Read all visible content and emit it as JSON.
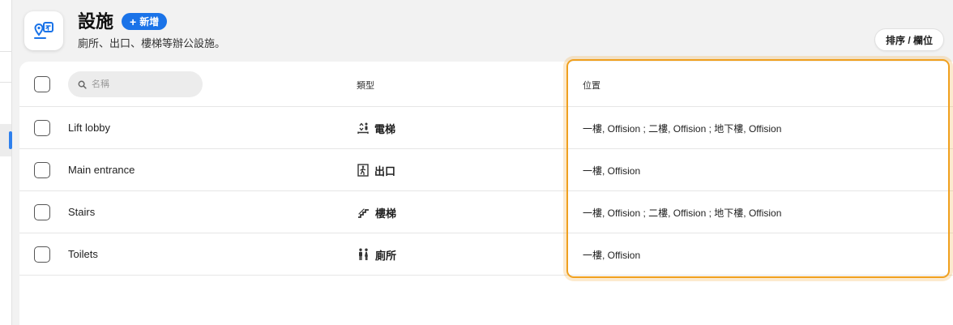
{
  "header": {
    "title": "設施",
    "new_label": "新增",
    "subtitle": "廁所、出口、樓梯等辦公設施。",
    "sort_label": "排序 / 欄位"
  },
  "table": {
    "search_placeholder": "名稱",
    "columns": {
      "type": "類型",
      "location": "位置"
    },
    "rows": [
      {
        "name": "Lift lobby",
        "type": "電梯",
        "type_icon": "elevator-icon",
        "location": "一樓, Offision ; 二樓, Offision ; 地下樓, Offision"
      },
      {
        "name": "Main entrance",
        "type": "出口",
        "type_icon": "exit-icon",
        "location": "一樓, Offision"
      },
      {
        "name": "Stairs",
        "type": "樓梯",
        "type_icon": "stairs-icon",
        "location": "一樓, Offision ; 二樓, Offision ; 地下樓, Offision"
      },
      {
        "name": "Toilets",
        "type": "廁所",
        "type_icon": "restroom-icon",
        "location": "一樓, Offision"
      }
    ]
  },
  "colors": {
    "accent": "#1a73e8",
    "highlight": "#f0a01e",
    "selection_indicator": "#2f80ed"
  }
}
